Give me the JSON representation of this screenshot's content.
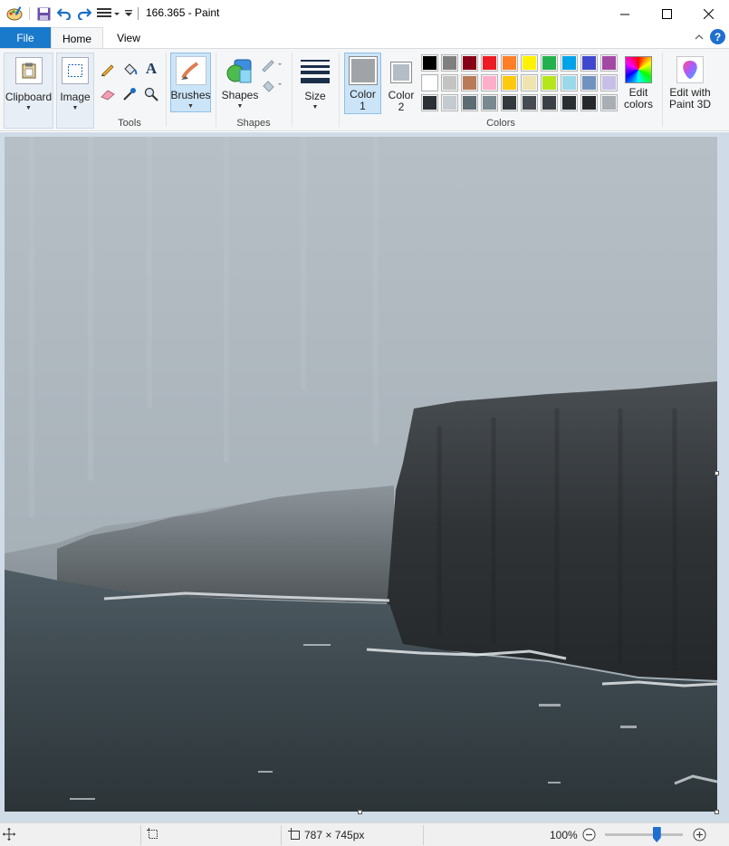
{
  "window": {
    "title": "166.365 - Paint",
    "controls": {
      "minimize": "minimize",
      "maximize": "maximize",
      "close": "close"
    }
  },
  "tabs": {
    "file": "File",
    "home": "Home",
    "view": "View"
  },
  "help": "?",
  "ribbon": {
    "clipboard": {
      "label": "Clipboard"
    },
    "image": {
      "label": "Image"
    },
    "tools": {
      "group_label": "Tools"
    },
    "brushes": {
      "label": "Brushes"
    },
    "shapes": {
      "label": "Shapes",
      "group_label": "Shapes"
    },
    "size": {
      "label": "Size"
    },
    "color1": {
      "label_line1": "Color",
      "label_line2": "1",
      "value": "#a0a4a8"
    },
    "color2": {
      "label_line1": "Color",
      "label_line2": "2",
      "value": "#b4bcc6"
    },
    "colors_group_label": "Colors",
    "edit_colors": {
      "line1": "Edit",
      "line2": "colors"
    },
    "paint3d": {
      "line1": "Edit with",
      "line2": "Paint 3D"
    },
    "palette": [
      "#000000",
      "#7f7f7f",
      "#880015",
      "#ed1c24",
      "#ff7f27",
      "#fff200",
      "#22b14c",
      "#00a2e8",
      "#3f48cc",
      "#a349a4",
      "#ffffff",
      "#c3c3c3",
      "#b97a57",
      "#ffaec9",
      "#ffc90e",
      "#efe4b0",
      "#b5e61d",
      "#99d9ea",
      "#7092be",
      "#c8bfe7",
      "#2b3035",
      "#c4cbd0",
      "#5d6b72",
      "#7a8890",
      "#32383c",
      "#454b50",
      "#3a4045",
      "#2a2e31",
      "#25292c",
      "#a8aeb2"
    ]
  },
  "statusbar": {
    "dimensions": "787 × 745px",
    "zoom": "100%",
    "zoom_fraction": 0.66
  }
}
